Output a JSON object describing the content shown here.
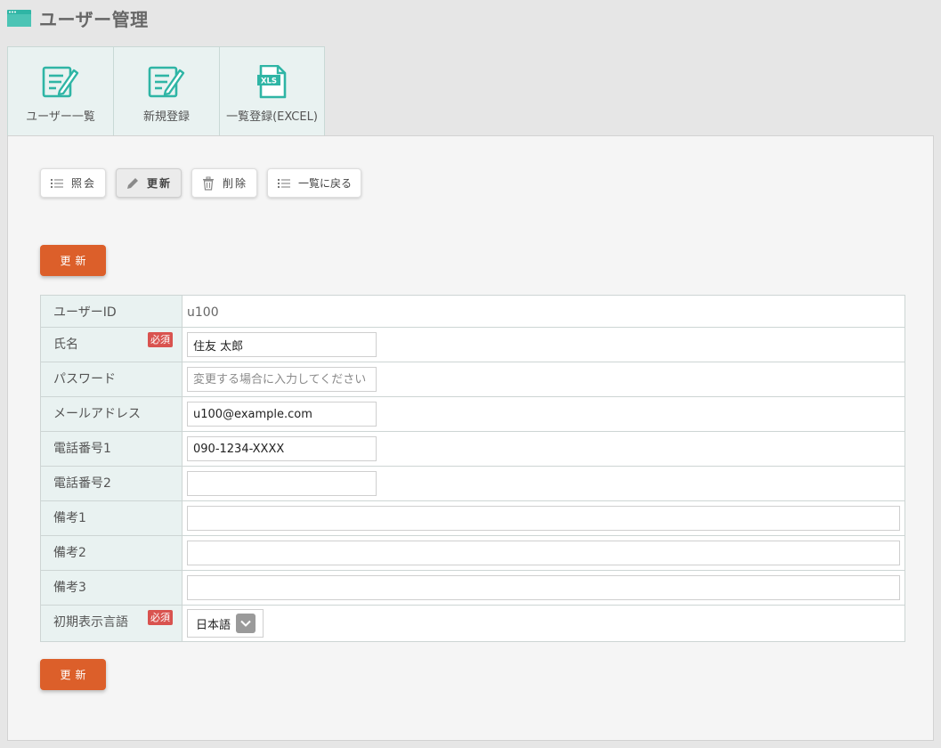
{
  "page": {
    "title": "ユーザー管理",
    "accent_color": "#2fb5a5",
    "title_icon": "window-icon"
  },
  "tabs": [
    {
      "label": "ユーザー一覧",
      "icon": "edit-list-icon"
    },
    {
      "label": "新規登録",
      "icon": "edit-list-icon"
    },
    {
      "label": "一覧登録(EXCEL)",
      "icon": "xls-file-icon",
      "badge": "XLS"
    }
  ],
  "actions": {
    "view": {
      "label": "照会",
      "icon": "list-icon"
    },
    "update": {
      "label": "更新",
      "icon": "pencil-icon"
    },
    "delete": {
      "label": "削除",
      "icon": "trash-icon"
    },
    "back": {
      "label": "一覧に戻る",
      "icon": "list-icon"
    }
  },
  "submit_label": "更新",
  "submit_color": "#dc5f2a",
  "required_label": "必須",
  "required_color": "#d9534f",
  "form": {
    "user_id": {
      "label": "ユーザーID",
      "value": "u100"
    },
    "name": {
      "label": "氏名",
      "value": "住友 太郎"
    },
    "password": {
      "label": "パスワード",
      "placeholder": "変更する場合に入力してください"
    },
    "email": {
      "label": "メールアドレス",
      "value": "u100@example.com"
    },
    "phone1": {
      "label": "電話番号1",
      "value": "090-1234-XXXX"
    },
    "phone2": {
      "label": "電話番号2",
      "value": ""
    },
    "note1": {
      "label": "備考1",
      "value": ""
    },
    "note2": {
      "label": "備考2",
      "value": ""
    },
    "note3": {
      "label": "備考3",
      "value": ""
    },
    "language": {
      "label": "初期表示言語",
      "selected": "日本語"
    }
  }
}
